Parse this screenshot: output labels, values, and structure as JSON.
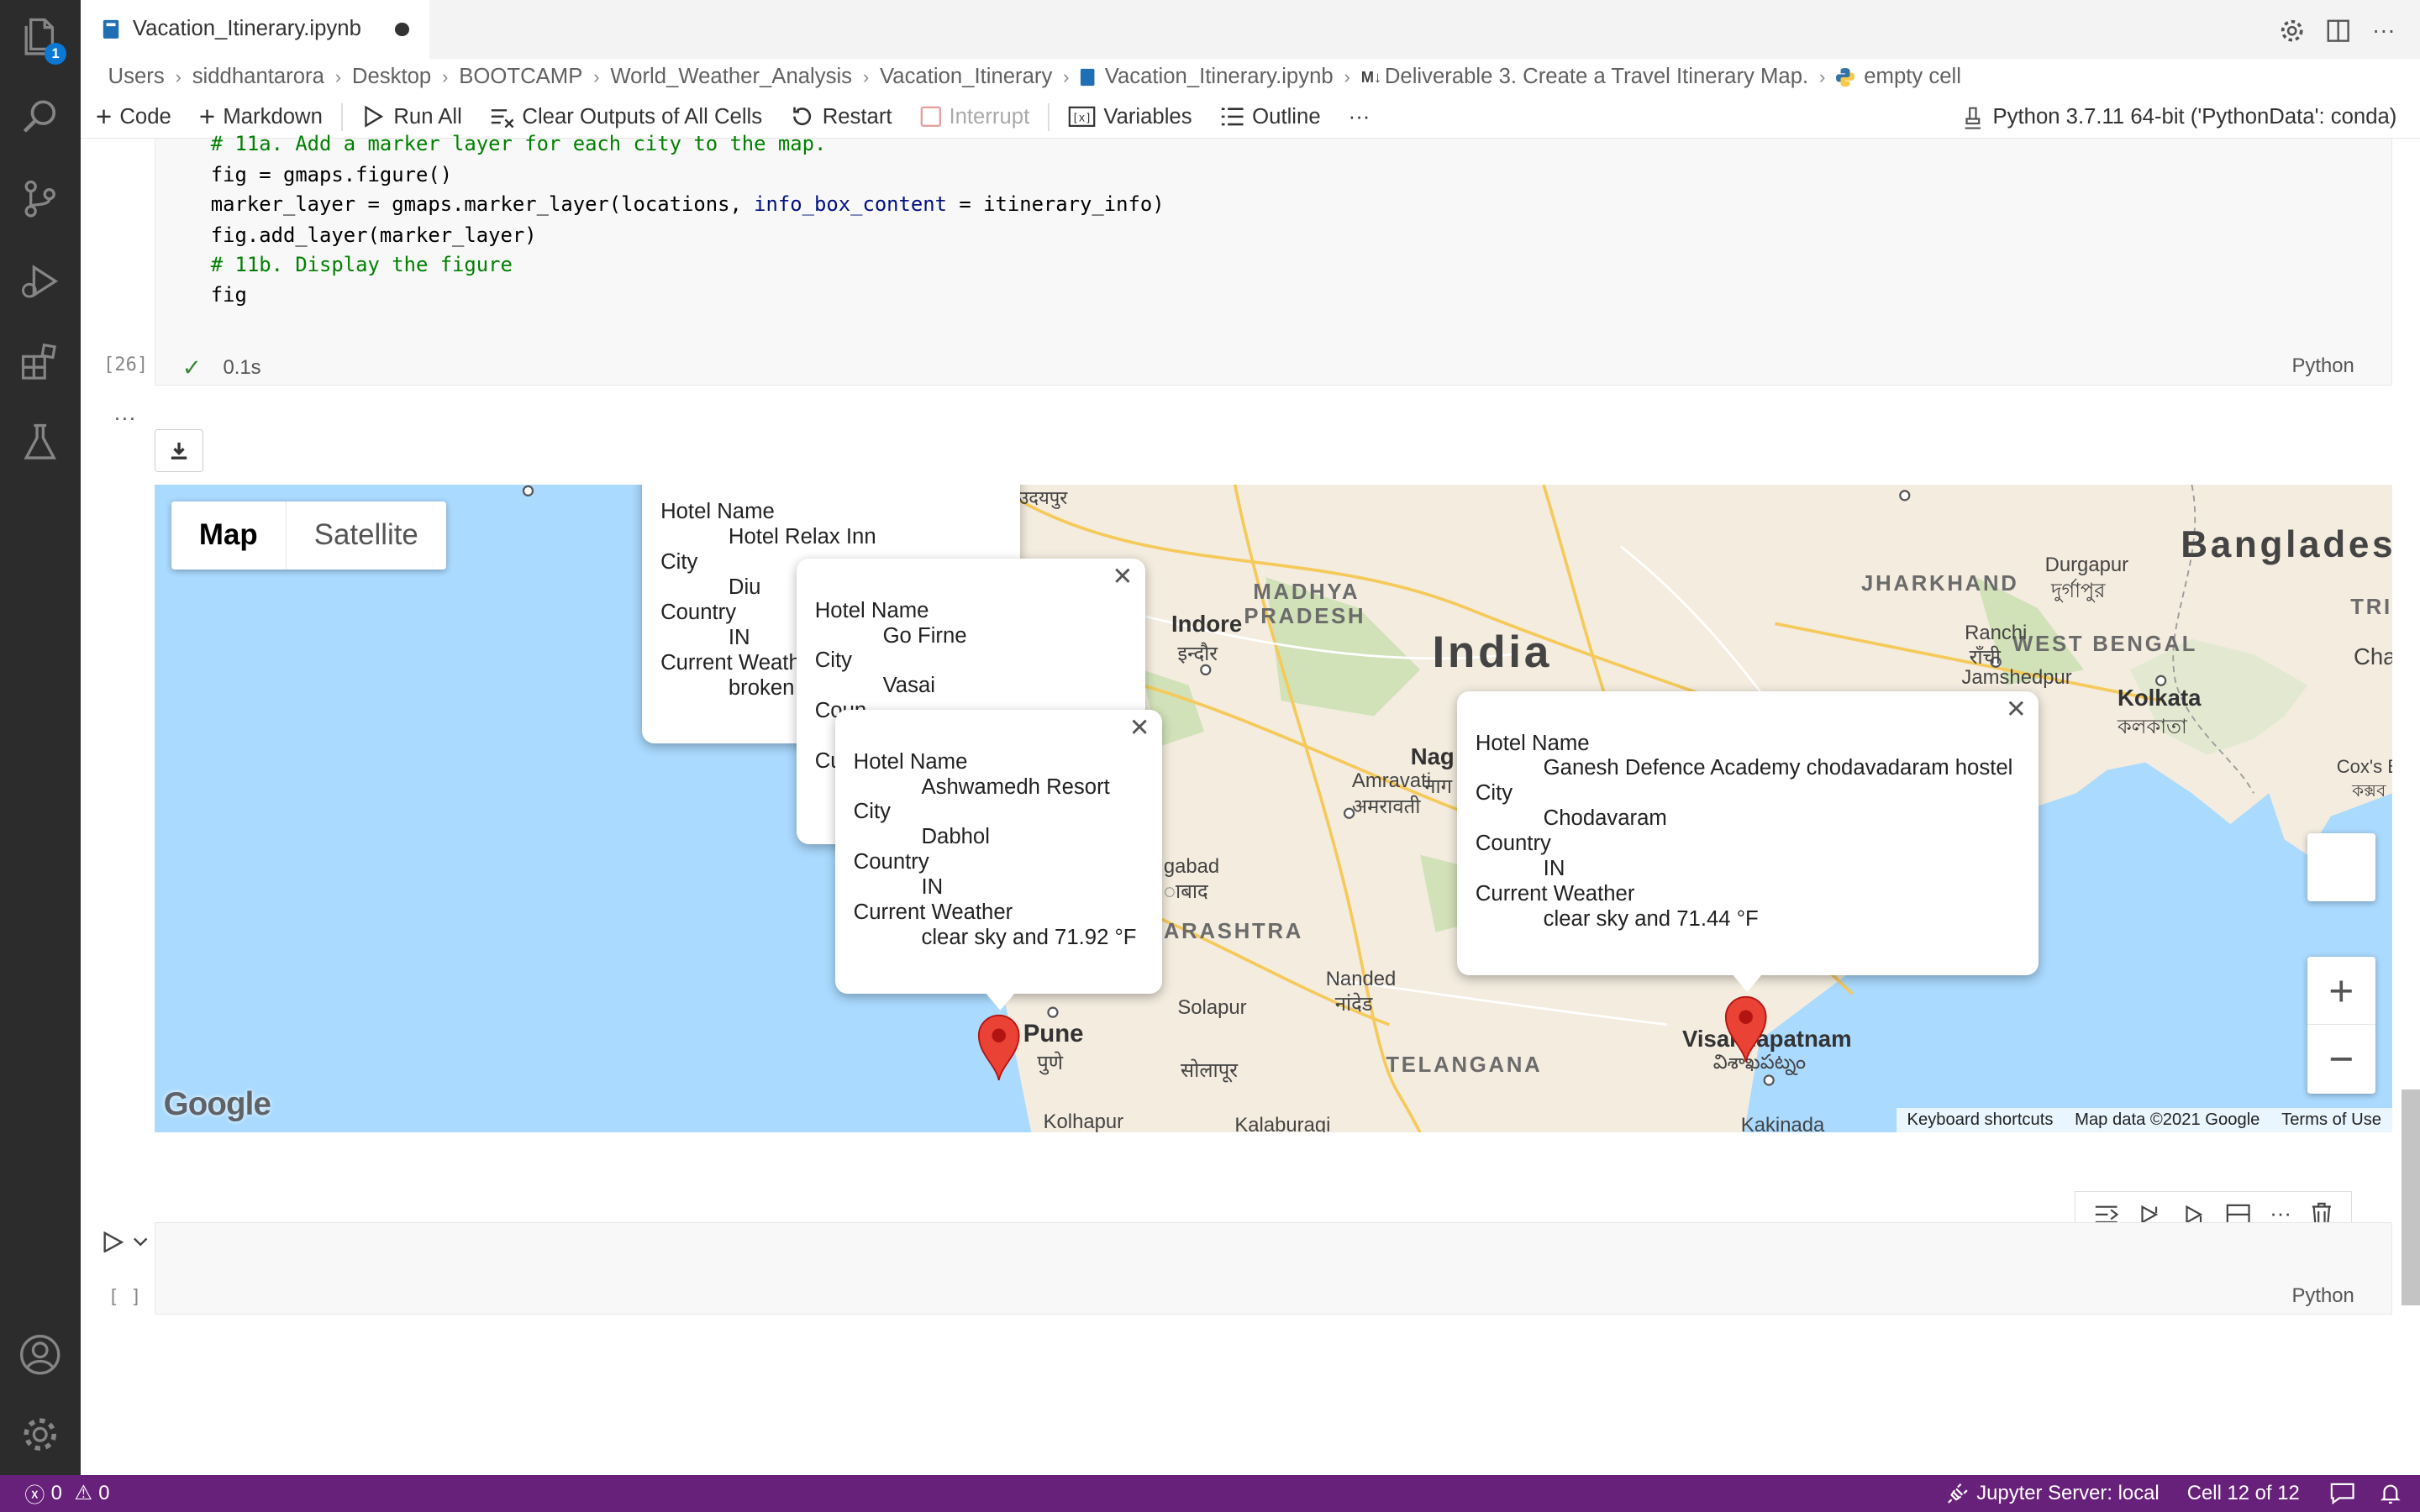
{
  "tab": {
    "title": "Vacation_Itinerary.ipynb"
  },
  "breadcrumb": [
    "Users",
    "siddhantarora",
    "Desktop",
    "BOOTCAMP",
    "World_Weather_Analysis",
    "Vacation_Itinerary",
    "Vacation_Itinerary.ipynb",
    "Deliverable 3. Create a Travel Itinerary Map.",
    "empty cell"
  ],
  "toolbar": {
    "code": "Code",
    "markdown": "Markdown",
    "run_all": "Run All",
    "clear_outputs": "Clear Outputs of All Cells",
    "restart": "Restart",
    "interrupt": "Interrupt",
    "variables": "Variables",
    "outline": "Outline",
    "more": "···",
    "kernel": "Python 3.7.11 64-bit ('PythonData': conda)"
  },
  "code_lines": [
    "# 11a. Add a marker layer for each city to the map.",
    "fig = gmaps.figure()",
    "marker_layer = gmaps.marker_layer(locations, info_box_content = itinerary_info)",
    "fig.add_layer(marker_layer)",
    "# 11b. Display the figure",
    "fig"
  ],
  "cell": {
    "exec_count": "[26]",
    "duration": "0.1s",
    "language": "Python",
    "output_ellipsis": "..."
  },
  "map": {
    "type_buttons": [
      "Map",
      "Satellite"
    ],
    "labels": {
      "india": "India",
      "bangladesh": "Banglades",
      "madhya": "MADHYA",
      "pradesh": "PRADESH",
      "jharkhand": "JHARKHAND",
      "west_bengal": "WEST BENGAL",
      "telangana": "TELANGANA",
      "rashtra": "ARASHTRA",
      "tri": "TRI",
      "indore": "Indore",
      "indore_hi": "इन्दौर",
      "kolkata": "Kolkata",
      "kolkata_bn": "কলকাতা",
      "ranchi": "Ranchi",
      "ranchi_hi": "राँची",
      "jamshedpur": "Jamshedpur",
      "durgapur": "Durgapur",
      "durgapur_bn": "দুর্গাপুর",
      "amravati": "Amravati",
      "amravati_mr": "अमरावती",
      "nag": "Nag",
      "nag_mr": "नाग",
      "nanded": "Nanded",
      "nanded_mr": "नांदेड",
      "pune": "Pune",
      "pune_mr": "पुणे",
      "solapur": "Solapur",
      "solapur_mr": "सोलापूर",
      "kolhapur": "Kolhapur",
      "kalaburagi": "Kalaburagi",
      "visakhapatnam": "Visakhapatnam",
      "visakhapatnam_te": "విశాఖపట్నం",
      "kakinada": "Kakinada",
      "cha": "Cha",
      "coxs": "Cox's Ba",
      "coxs_bn": "কক্সব",
      "gabad": "gabad",
      "gabad_mr": "ाबाद",
      "udaipur": "उदयपुर"
    },
    "google_logo": "Google",
    "attribution": [
      "Keyboard shortcuts",
      "Map data ©2021 Google",
      "Terms of Use"
    ],
    "zoom_in": "+",
    "zoom_out": "−"
  },
  "popups": [
    {
      "fields": [
        [
          "Hotel Name",
          "Hotel Relax Inn"
        ],
        [
          "City",
          "Diu"
        ],
        [
          "Country",
          "IN"
        ],
        [
          "Current Weath",
          "broken"
        ]
      ]
    },
    {
      "fields": [
        [
          "Hotel Name",
          "Go Firne"
        ],
        [
          "City",
          "Vasai"
        ],
        [
          "Coun",
          ""
        ],
        [
          "Cu",
          ""
        ]
      ]
    },
    {
      "fields": [
        [
          "Hotel Name",
          "Ashwamedh Resort"
        ],
        [
          "City",
          "Dabhol"
        ],
        [
          "Country",
          "IN"
        ],
        [
          "Current Weather",
          "clear sky and 71.92 °F"
        ]
      ]
    },
    {
      "fields": [
        [
          "Hotel Name",
          "Ganesh Defence Academy chodavadaram hostel"
        ],
        [
          "City",
          "Chodavaram"
        ],
        [
          "Country",
          "IN"
        ],
        [
          "Current Weather",
          "clear sky and 71.44 °F"
        ]
      ]
    }
  ],
  "empty_cell": {
    "exec_count": "[ ]",
    "language": "Python"
  },
  "statusbar": {
    "errors": "0",
    "warnings": "0",
    "jupyter": "Jupyter Server: local",
    "cell_pos": "Cell 12 of 12"
  },
  "activity_badge": "1",
  "colors": {
    "statusbar": "#68217a",
    "accent": "#0b78d4",
    "water": "#aadaff",
    "marker": "#ea4335"
  }
}
